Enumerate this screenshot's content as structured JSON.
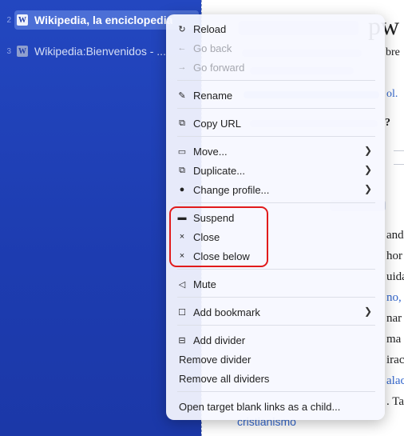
{
  "sidebar": {
    "tabs": [
      {
        "num": "2",
        "title": "Wikipedia, la enciclopedia"
      },
      {
        "num": "3",
        "title": "Wikipedia:Bienvenidos - ..."
      }
    ]
  },
  "page": {
    "heading_fragment": "pw",
    "line1": "bre",
    "line2": "ol.",
    "line3": "?",
    "lines": [
      "ando",
      "hor",
      "uida",
      "no, c",
      "nar",
      "ma",
      "irac",
      "alac",
      ". Ta"
    ],
    "bottom_link": "cristianismo"
  },
  "menu": {
    "items": [
      {
        "label": "Reload",
        "icon": "↻",
        "icon_name": "reload-icon",
        "disabled": false
      },
      {
        "label": "Go back",
        "icon": "←",
        "icon_name": "back-arrow-icon",
        "disabled": true
      },
      {
        "label": "Go forward",
        "icon": "→",
        "icon_name": "forward-arrow-icon",
        "disabled": true
      },
      {
        "label": "Rename",
        "icon": "✎",
        "icon_name": "rename-icon",
        "disabled": false
      },
      {
        "label": "Copy URL",
        "icon": "⧉",
        "icon_name": "copy-icon",
        "disabled": false
      },
      {
        "label": "Move...",
        "icon": "▭",
        "icon_name": "move-icon",
        "disabled": false,
        "submenu": true
      },
      {
        "label": "Duplicate...",
        "icon": "⧉",
        "icon_name": "duplicate-icon",
        "disabled": false,
        "submenu": true
      },
      {
        "label": "Change profile...",
        "icon": "●",
        "icon_name": "profile-icon",
        "disabled": false,
        "submenu": true
      },
      {
        "label": "Suspend",
        "icon": "▬",
        "icon_name": "suspend-icon",
        "disabled": false
      },
      {
        "label": "Close",
        "icon": "×",
        "icon_name": "close-icon",
        "disabled": false
      },
      {
        "label": "Close below",
        "icon": "×",
        "icon_name": "close-below-icon",
        "disabled": false
      },
      {
        "label": "Mute",
        "icon": "◁",
        "icon_name": "mute-icon",
        "disabled": false
      },
      {
        "label": "Add bookmark",
        "icon": "☐",
        "icon_name": "bookmark-icon",
        "disabled": false,
        "submenu": true
      },
      {
        "label": "Add divider",
        "icon": "⊟",
        "icon_name": "divider-icon",
        "disabled": false
      },
      {
        "label": "Remove divider",
        "disabled": false
      },
      {
        "label": "Remove all dividers",
        "disabled": false
      },
      {
        "label": "Open target blank links as a child...",
        "disabled": false
      }
    ]
  },
  "colors": {
    "sidebar": "#1e3fb0",
    "active_tab": "#4c6fd6",
    "highlight": "#e11b1b"
  }
}
